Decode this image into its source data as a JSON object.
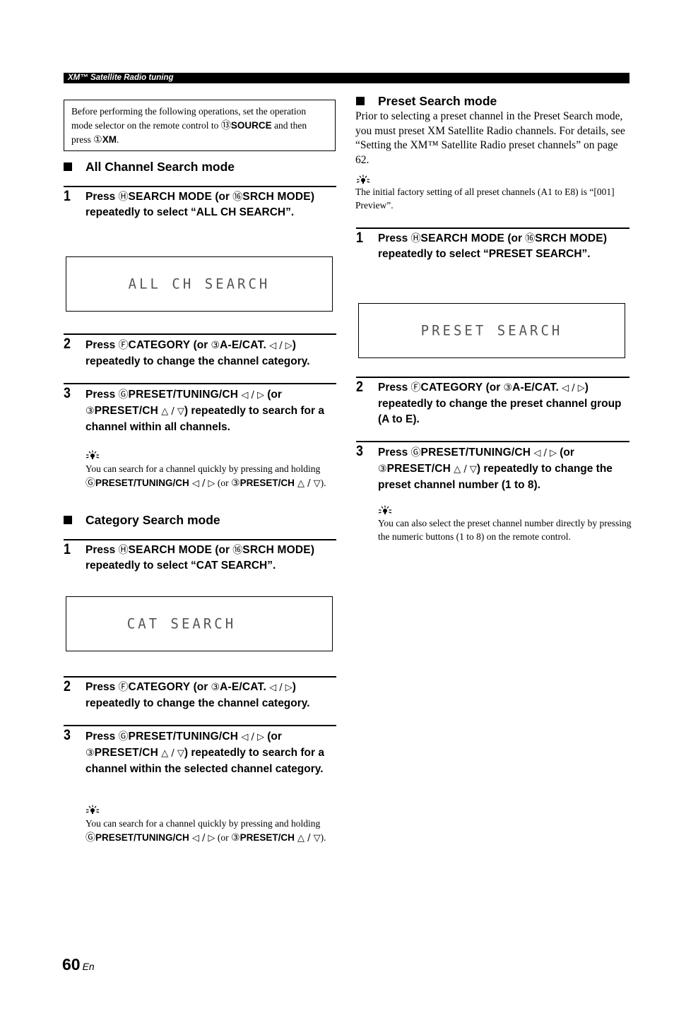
{
  "header": {
    "title": "XM™ Satellite Radio tuning"
  },
  "note": {
    "text_1": "Before performing the following operations, set the operation mode selector on the remote control to ",
    "key_1_num": "⑬",
    "key_1_label": "SOURCE",
    "text_2": " and then press ",
    "key_2_num": "①",
    "key_2_label": "XM",
    "text_3": "."
  },
  "left": {
    "all_channel": {
      "heading": "All Channel Search mode",
      "step1": {
        "num": "1",
        "press": "Press ",
        "key_a": "Ⓗ",
        "label_a": "SEARCH MODE",
        "or": " (or ",
        "key_b": "⑯",
        "label_b": "SRCH MODE",
        "rest": ") repeatedly to select “ALL CH SEARCH”."
      },
      "display": "ALL CH SEARCH",
      "step2": {
        "num": "2",
        "press": "Press ",
        "key_a": "Ⓕ",
        "label_a": "CATEGORY",
        "or": " (or ",
        "key_b": "③",
        "label_b": "A-E/CAT.",
        "arrows": " ◁ / ▷",
        "rest": ") repeatedly to change the channel category."
      },
      "step3": {
        "num": "3",
        "press": "Press ",
        "key_a": "Ⓖ",
        "label_a": "PRESET/TUNING/CH",
        "arrows_a": " ◁ / ▷",
        "or": " (or ",
        "key_b": "③",
        "label_b": "PRESET/CH",
        "arrows_b": " △ / ▽",
        "rest": ") repeatedly to search for a channel within all channels."
      },
      "tip": {
        "text_1": "You can search for a channel quickly by pressing and holding ",
        "key_a": "Ⓖ",
        "label_a": "PRESET/TUNING/CH",
        "arrows_a": " ◁ / ▷",
        "or": " (or ",
        "key_b": "③",
        "label_b": "PRESET/CH",
        "arrows_b": " △ / ▽",
        "end": ")."
      }
    },
    "category": {
      "heading": "Category Search mode",
      "step1": {
        "num": "1",
        "press": "Press ",
        "key_a": "Ⓗ",
        "label_a": "SEARCH MODE",
        "or": " (or ",
        "key_b": "⑯",
        "label_b": "SRCH MODE",
        "rest": ") repeatedly to select “CAT SEARCH”."
      },
      "display": "CAT SEARCH",
      "step2": {
        "num": "2",
        "press": "Press ",
        "key_a": "Ⓕ",
        "label_a": "CATEGORY",
        "or": " (or ",
        "key_b": "③",
        "label_b": "A-E/CAT.",
        "arrows": " ◁ / ▷",
        "rest": ") repeatedly to change the channel category."
      },
      "step3": {
        "num": "3",
        "press": "Press ",
        "key_a": "Ⓖ",
        "label_a": "PRESET/TUNING/CH",
        "arrows_a": " ◁ / ▷",
        "or": " (or ",
        "key_b": "③",
        "label_b": "PRESET/CH",
        "arrows_b": " △ / ▽",
        "rest": ") repeatedly to search for a channel within the selected channel category."
      },
      "tip": {
        "text_1": "You can search for a channel quickly by pressing and holding ",
        "key_a": "Ⓖ",
        "label_a": "PRESET/TUNING/CH",
        "arrows_a": " ◁ / ▷",
        "or": " (or ",
        "key_b": "③",
        "label_b": "PRESET/CH",
        "arrows_b": " △ / ▽",
        "end": ")."
      }
    }
  },
  "right": {
    "preset": {
      "heading": "Preset Search mode",
      "intro": "Prior to selecting a preset channel in the Preset Search mode, you must preset XM Satellite Radio channels. For details, see “Setting the XM™ Satellite Radio preset channels” on page 62.",
      "intro_tip": "The initial factory setting of all preset channels (A1 to E8) is “[001] Preview”.",
      "step1": {
        "num": "1",
        "press": "Press ",
        "key_a": "Ⓗ",
        "label_a": "SEARCH MODE",
        "or": " (or ",
        "key_b": "⑯",
        "label_b": "SRCH MODE",
        "rest": ") repeatedly to select “PRESET SEARCH”."
      },
      "display": "PRESET SEARCH",
      "step2": {
        "num": "2",
        "press": "Press ",
        "key_a": "Ⓕ",
        "label_a": "CATEGORY",
        "or": " (or ",
        "key_b": "③",
        "label_b": "A-E/CAT.",
        "arrows": " ◁ / ▷",
        "rest": ") repeatedly to change the preset channel group (A to E)."
      },
      "step3": {
        "num": "3",
        "press": "Press ",
        "key_a": "Ⓖ",
        "label_a": "PRESET/TUNING/CH",
        "arrows_a": " ◁ / ▷",
        "or": " (or ",
        "key_b": "③",
        "label_b": "PRESET/CH",
        "arrows_b": " △ / ▽",
        "rest": ") repeatedly to change the preset channel number (1 to 8)."
      },
      "tip": "You can also select the preset channel number directly by pressing the numeric buttons (1 to 8) on the remote control."
    }
  },
  "footer": {
    "page": "60",
    "lang": "En"
  }
}
